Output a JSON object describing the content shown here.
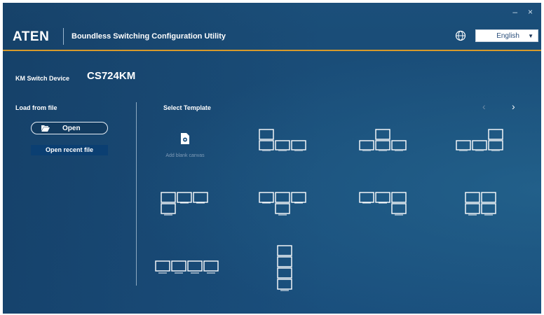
{
  "window": {
    "minimize_glyph": "–",
    "close_glyph": "×"
  },
  "header": {
    "logo": "ATEN",
    "title": "Boundless Switching Configuration Utility",
    "language": {
      "value": "English",
      "arrow": "▼",
      "icon": "globe-icon"
    }
  },
  "device": {
    "label": "KM Switch Device",
    "name": "CS724KM"
  },
  "load": {
    "title": "Load from file",
    "open_label": "Open",
    "open_icon": "folder-open-icon",
    "recent_label": "Open recent file"
  },
  "templates": {
    "title": "Select Template",
    "prev": "‹",
    "next": "›",
    "blank_label": "Add blank canvas",
    "blank_icon": "add-document-icon"
  },
  "colors": {
    "accent": "#d79a2b",
    "monitor_stroke": "#ffffff",
    "background": "#1a4f7d"
  }
}
